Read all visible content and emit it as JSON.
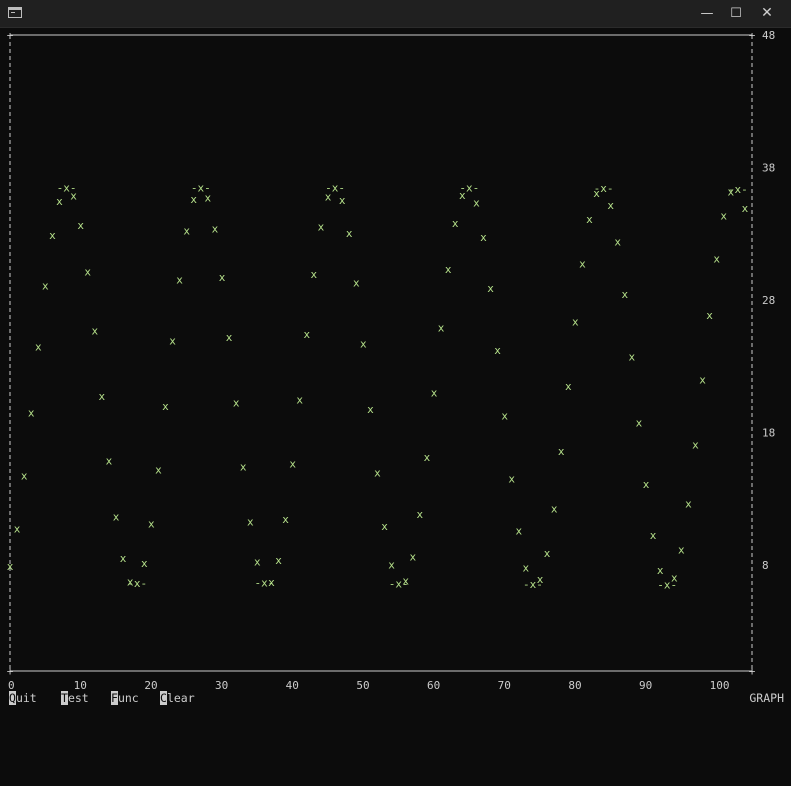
{
  "window": {
    "icon": "console-icon",
    "minimize_glyph": "—",
    "maximize_glyph": "☐",
    "close_glyph": "✕"
  },
  "menu": [
    {
      "key": "Q",
      "rest": "uit",
      "name": "menu-quit"
    },
    {
      "key": "T",
      "rest": "est",
      "name": "menu-test"
    },
    {
      "key": "F",
      "rest": "unc",
      "name": "menu-func"
    },
    {
      "key": "C",
      "rest": "lear",
      "name": "menu-clear"
    }
  ],
  "mode_label": "GRAPH",
  "colors": {
    "background": "#0c0c0c",
    "foreground": "#cccccc",
    "plot_mark": "#b5e08a"
  },
  "chart_data": {
    "type": "scatter",
    "marker": "x",
    "peak_marker": "-x-",
    "xlim": [
      0,
      105
    ],
    "ylim": [
      0,
      48
    ],
    "x_ticks": [
      0,
      10,
      20,
      30,
      40,
      50,
      60,
      70,
      80,
      90,
      100
    ],
    "y_ticks": [
      8,
      18,
      28,
      38,
      48
    ],
    "function": "y = 21.5 + 15*sin(2*pi*(x - 3.4)/18.9)",
    "x_step": 1,
    "x_start": 0,
    "x_end": 104
  }
}
